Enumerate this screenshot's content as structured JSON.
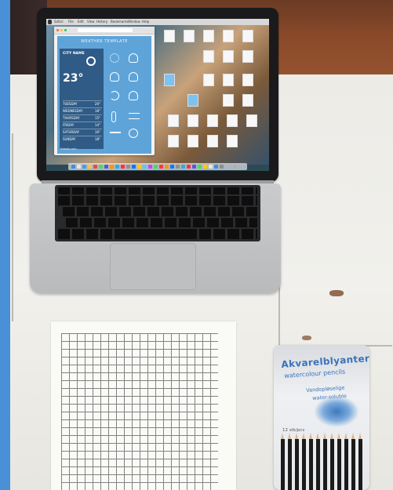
{
  "colors": {
    "side_accent": "#4a90d6",
    "tin_text": "#3a73b8",
    "weather_panel": "#2f5b86",
    "weather_bg": "#5fa4d8"
  },
  "screen": {
    "menu_items": [
      "Safari",
      "File",
      "Edit",
      "View",
      "History",
      "Bookmarks",
      "Window",
      "Help"
    ],
    "browser_title": "WEATHER TEMPLATE",
    "weather": {
      "city": "CITY NAME",
      "temp": "23°",
      "days": [
        "TUESDAY",
        "WEDNESDAY",
        "THURSDAY",
        "FRIDAY",
        "SATURDAY",
        "SUNDAY"
      ],
      "day_temps": [
        "20°",
        "18°",
        "15°",
        "14°",
        "16°",
        "18°"
      ],
      "footer": "freepik.com"
    }
  },
  "tin": {
    "title": "Akvarelblyanter",
    "subtitle": "watercolour pencils",
    "line1": "Vandopløselige",
    "line2": "water-soluble",
    "count": "12 stk/pcs"
  },
  "icons": {
    "sun": "sun-icon",
    "snow": "snowflake-icon",
    "cloud": "cloud-icon",
    "moon": "moon-icon",
    "rain": "rain-icon",
    "wind": "wind-icon"
  }
}
